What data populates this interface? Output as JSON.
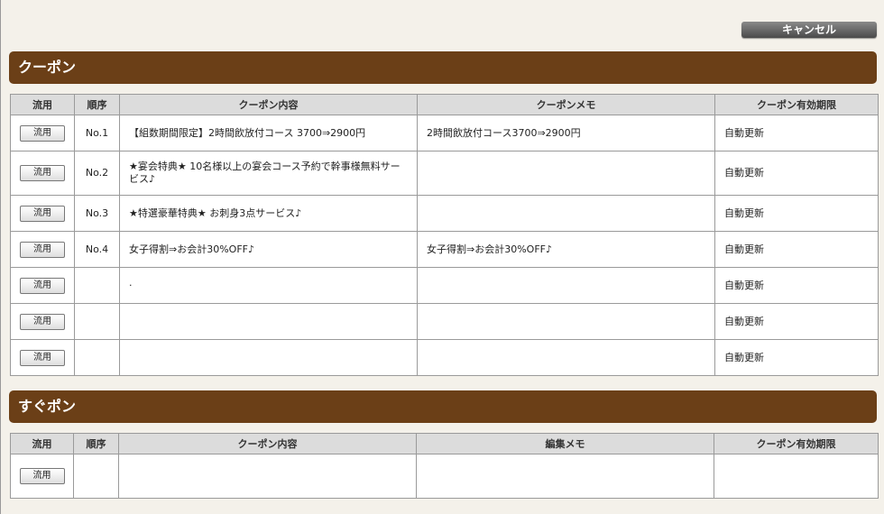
{
  "cancel_label": "キャンセル",
  "coupon_section": {
    "title": "クーポン",
    "headers": [
      "流用",
      "順序",
      "クーポン内容",
      "クーポンメモ",
      "クーポン有効期限"
    ],
    "rows": [
      {
        "button": "流用",
        "order": "No.1",
        "content": "【組数期間限定】2時間飲放付コース 3700⇒2900円",
        "memo": "2時間飲放付コース3700⇒2900円",
        "expiry": "自動更新"
      },
      {
        "button": "流用",
        "order": "No.2",
        "content": "★宴会特典★ 10名様以上の宴会コース予約で幹事様無料サービス♪",
        "memo": "",
        "expiry": "自動更新"
      },
      {
        "button": "流用",
        "order": "No.3",
        "content": "★特選豪華特典★ お刺身3点サービス♪",
        "memo": "",
        "expiry": "自動更新"
      },
      {
        "button": "流用",
        "order": "No.4",
        "content": "女子得割⇒お会計30%OFF♪",
        "memo": "女子得割⇒お会計30%OFF♪",
        "expiry": "自動更新"
      },
      {
        "button": "流用",
        "order": "",
        "content": "·",
        "memo": "",
        "expiry": "自動更新"
      },
      {
        "button": "流用",
        "order": "",
        "content": "",
        "memo": "",
        "expiry": "自動更新"
      },
      {
        "button": "流用",
        "order": "",
        "content": "",
        "memo": "",
        "expiry": "自動更新"
      }
    ]
  },
  "sugupon_section": {
    "title": "すぐポン",
    "headers": [
      "流用",
      "順序",
      "クーポン内容",
      "編集メモ",
      "クーポン有効期限"
    ],
    "rows": [
      {
        "button": "流用",
        "order": "",
        "content": "",
        "memo": "",
        "expiry": ""
      }
    ]
  }
}
